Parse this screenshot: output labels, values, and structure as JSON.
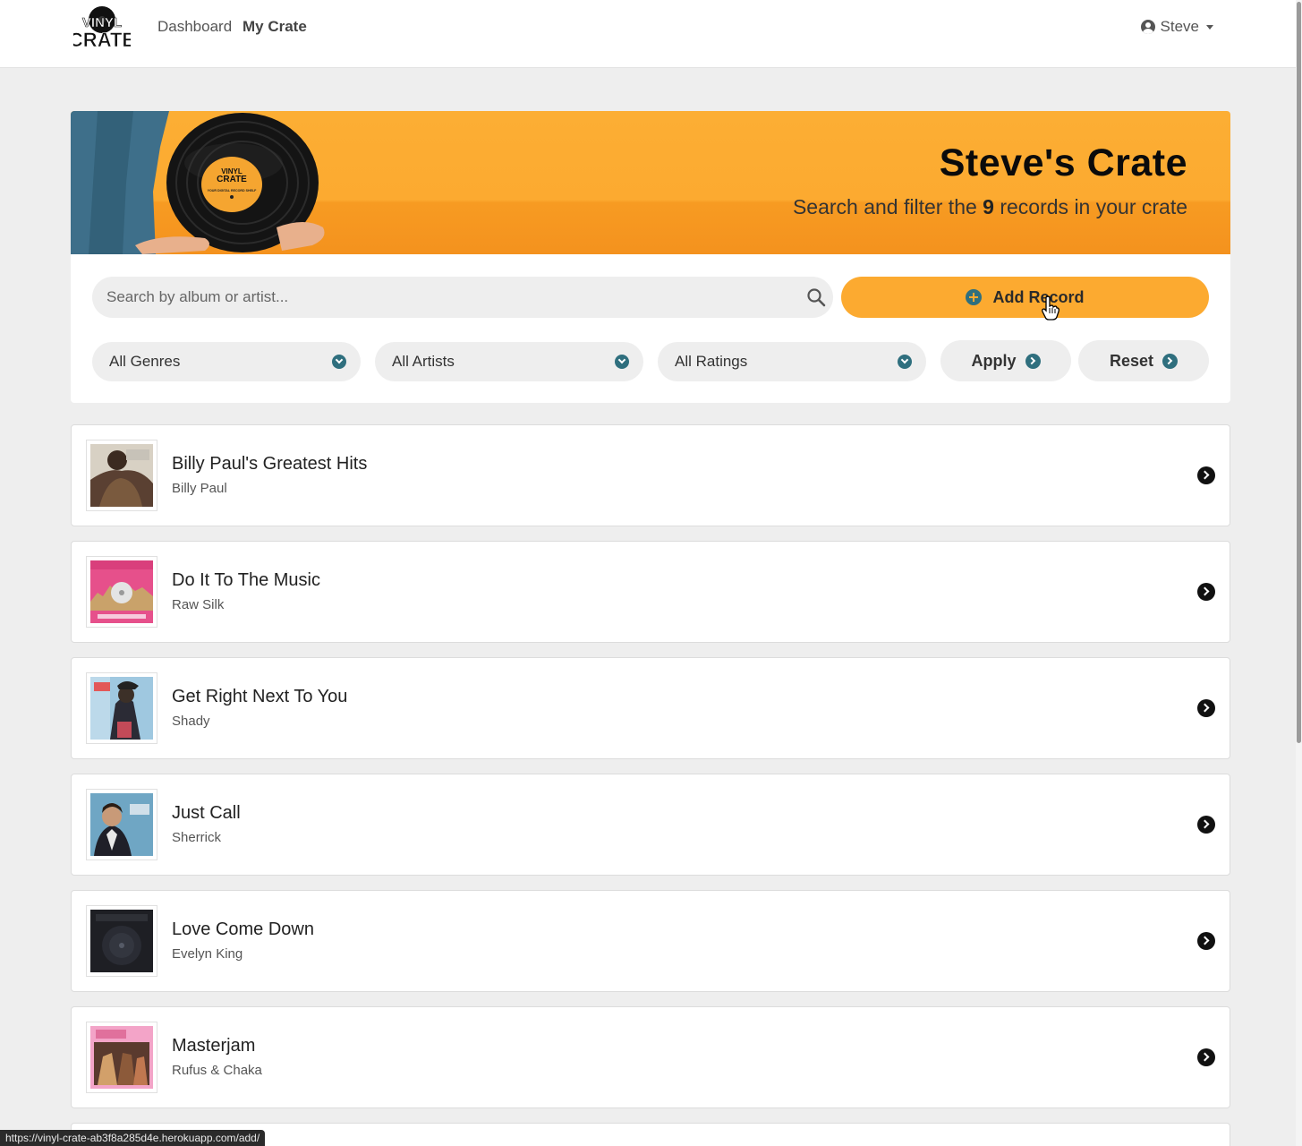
{
  "nav": {
    "logo_line1": "VINYL",
    "logo_line2": "CRATE",
    "links": [
      "Dashboard",
      "My Crate"
    ],
    "active": "My Crate",
    "user": "Steve"
  },
  "hero": {
    "title": "Steve's Crate",
    "subtitle_pre": "Search and filter the ",
    "count": "9",
    "subtitle_post": " records in your crate",
    "label_line1": "VINYL",
    "label_line2": "CRATE",
    "label_text": "YOUR DIGITAL RECORD SHELF"
  },
  "filters": {
    "search_placeholder": "Search by album or artist...",
    "add_label": "Add Record",
    "genre": "All Genres",
    "artist": "All Artists",
    "rating": "All Ratings",
    "apply_label": "Apply",
    "reset_label": "Reset"
  },
  "records": [
    {
      "title": "Billy Paul's Greatest Hits",
      "artist": "Billy Paul"
    },
    {
      "title": "Do It To The Music",
      "artist": "Raw Silk"
    },
    {
      "title": "Get Right Next To You",
      "artist": "Shady"
    },
    {
      "title": "Just Call",
      "artist": "Sherrick"
    },
    {
      "title": "Love Come Down",
      "artist": "Evelyn King"
    },
    {
      "title": "Masterjam",
      "artist": "Rufus & Chaka"
    }
  ],
  "status_url": "https://vinyl-crate-ab3f8a285d4e.herokuapp.com/add/",
  "colors": {
    "accent": "#fcaa30",
    "icon_teal": "#2f6f7e",
    "page_bg": "#eeeeee"
  }
}
